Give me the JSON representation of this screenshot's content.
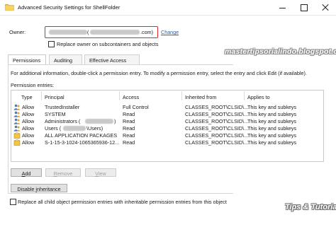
{
  "window": {
    "title": "Advanced Security Settings for ShellFolder"
  },
  "owner": {
    "label": "Owner:",
    "paren_open": "(",
    "domain_suffix": ".com)",
    "change_link": "Change",
    "replace_checkbox_label": "Replace owner on subcontainers and objects",
    "replace_checked": false
  },
  "watermark": {
    "top": "mastertipsorialindo.blogspot.com",
    "bottom": "Tips & Tutorial"
  },
  "tabs": [
    {
      "label": "Permissions",
      "active": true
    },
    {
      "label": "Auditing",
      "active": false
    },
    {
      "label": "Effective Access",
      "active": false
    }
  ],
  "info_text": "For additional information, double-click a permission entry. To modify a permission entry, select the entry and click Edit (if available).",
  "entries_label": "Permission entries:",
  "table": {
    "columns": [
      "Type",
      "Principal",
      "Access",
      "Inherited from",
      "Applies to"
    ],
    "rows": [
      {
        "type": "Allow",
        "principal": "TrustedInstaller",
        "access": "Full Control",
        "inherited": "CLASSES_ROOT\\CLSID\\...",
        "applies": "This key and subkeys"
      },
      {
        "type": "Allow",
        "principal": "SYSTEM",
        "access": "Read",
        "inherited": "CLASSES_ROOT\\CLSID\\...",
        "applies": "This key and subkeys"
      },
      {
        "type": "Allow",
        "principal": "Administrators (",
        "principal_suffix": ")",
        "access": "Read",
        "inherited": "CLASSES_ROOT\\CLSID\\...",
        "applies": "This key and subkeys"
      },
      {
        "type": "Allow",
        "principal": "Users (",
        "principal_suffix": "\\Users)",
        "access": "Read",
        "inherited": "CLASSES_ROOT\\CLSID\\...",
        "applies": "This key and subkeys"
      },
      {
        "type": "Allow",
        "principal": "ALL APPLICATION PACKAGES",
        "access": "Read",
        "inherited": "CLASSES_ROOT\\CLSID\\...",
        "applies": "This key and subkeys"
      },
      {
        "type": "Allow",
        "principal": "S-1-15-3-1024-1065365936-12...",
        "access": "Read",
        "inherited": "CLASSES_ROOT\\CLSID\\...",
        "applies": "This key and subkeys"
      }
    ]
  },
  "buttons": {
    "add_mnemonic": "A",
    "add_rest": "dd",
    "remove_mnemonic": "R",
    "remove_rest": "emove",
    "view_mnemonic": "V",
    "view_rest": "iew",
    "disable_pre": "Disable ",
    "disable_mnemonic": "i",
    "disable_rest": "nheritance"
  },
  "replace_child": {
    "label": "Replace all child object permission entries with inheritable permission entries from this object",
    "checked": false
  },
  "colors": {
    "highlight_border": "#e0262b",
    "link": "#1e5fbf"
  }
}
